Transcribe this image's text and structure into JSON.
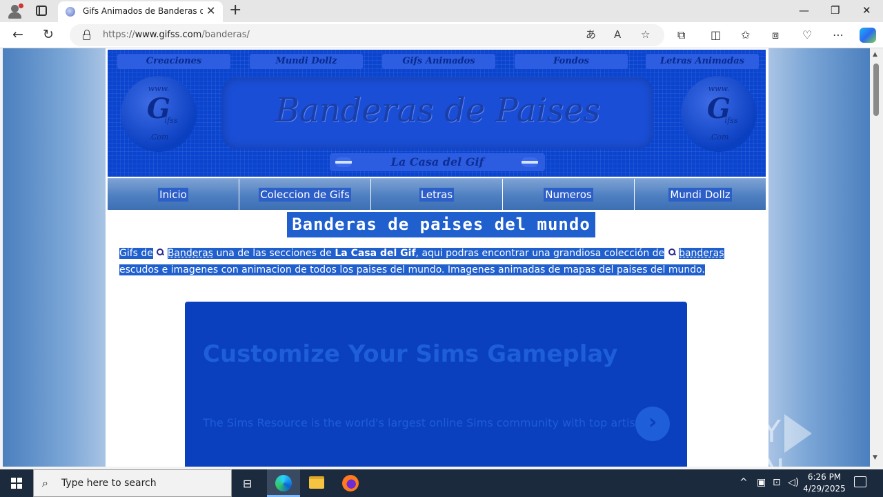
{
  "browser": {
    "tab_title": "Gifs Animados de Banderas del Mundo",
    "tab_close": "✕",
    "new_tab": "+",
    "url_prefix": "https://",
    "url_host": "www.gifss.com",
    "url_path": "/banderas/",
    "window": {
      "minimize": "—",
      "restore": "❐",
      "close": "✕"
    }
  },
  "banner": {
    "menu": [
      "Creaciones",
      "Mundi Dollz",
      "Gifs Animados",
      "Fondos",
      "Letras Animadas"
    ],
    "badge_top": "www.",
    "badge_g": "G",
    "badge_ifss": "ifss",
    "badge_com": ".Com",
    "title": "Banderas de Paises",
    "subtitle": "La Casa del Gif"
  },
  "nav": [
    "Inicio",
    "Coleccion de Gifs",
    "Letras",
    "Numeros",
    "Mundi Dollz"
  ],
  "content": {
    "heading": "Banderas de paises del mundo",
    "p_part1": "Gifs de",
    "p_kw1": "Banderas",
    "p_part2": " una de las secciones de ",
    "p_bold": "La Casa del Gif",
    "p_part3": ", aqui podras encontrar una grandiosa colección de",
    "p_kw2": "banderas",
    "p_part4": " escudos e imagenes con animacion de todos los paises del mundo. Imagenes animadas de mapas del paises del mundo."
  },
  "ad": {
    "headline": "Customize Your Sims Gameplay",
    "description": "The Sims Resource is the world's largest online Sims community with top artists.",
    "arrow": "›"
  },
  "watermark": {
    "left": "ANY",
    "right": "RUN"
  },
  "taskbar": {
    "search_placeholder": "Type here to search",
    "time": "6:26 PM",
    "date": "4/29/2025"
  },
  "colors": {
    "selection": "#1f5fce",
    "banner": "#0a44cf",
    "ad_bg": "#0a3fbe"
  }
}
